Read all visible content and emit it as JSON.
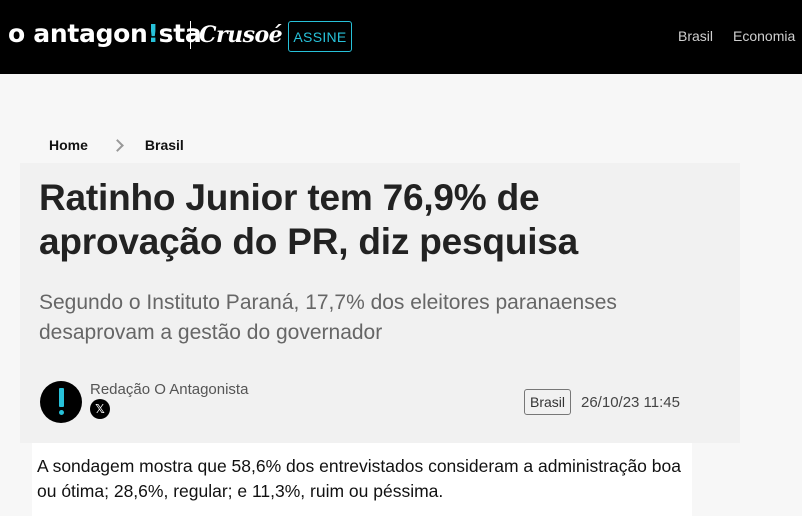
{
  "header": {
    "logo_pre": "o antagon",
    "logo_bang": "!",
    "logo_post": "sta",
    "logo_crusoe": "Crusoé",
    "subscribe_label": "ASSINE",
    "nav": [
      "Brasil",
      "Economia"
    ]
  },
  "breadcrumb": [
    "Home",
    "Brasil"
  ],
  "article": {
    "title": "Ratinho Junior tem 76,9% de aprovação do PR, diz pesquisa",
    "subtitle": "Segundo o Instituto Paraná, 17,7% dos eleitores paranaenses desaprovam a gestão do governador",
    "author": "Redação O Antagonista",
    "social_icon": "x-icon",
    "category": "Brasil",
    "date": "26/10/23 11:45",
    "lead": "A sondagem mostra que 58,6% dos entrevistados consideram a administração boa ou ótima; 28,6%, regular; e 11,3%, ruim ou péssima."
  },
  "colors": {
    "accent": "#27c1d9",
    "header_bg": "#000000"
  }
}
